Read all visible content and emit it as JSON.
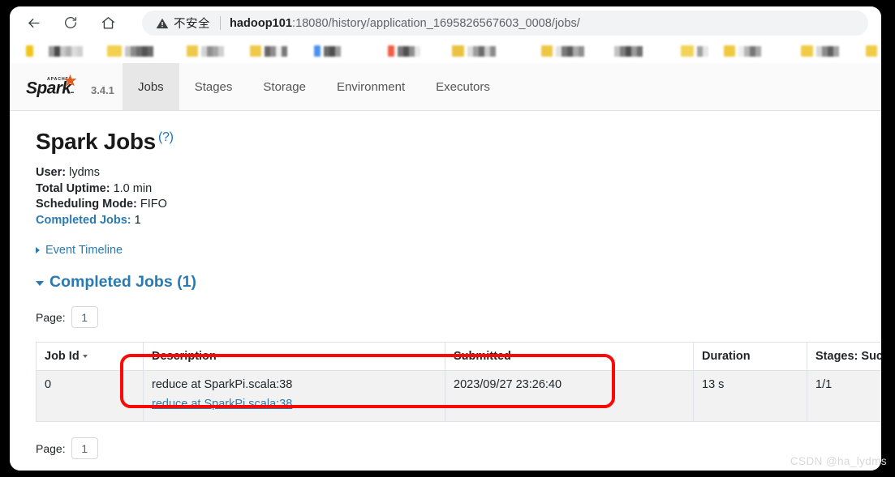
{
  "browser": {
    "nav": {
      "back": "back-arrow",
      "reload": "reload",
      "home": "home"
    },
    "omnibox": {
      "security_label": "不安全",
      "url_host": "hadoop101",
      "url_path": ":18080/history/application_1695826567603_0008/jobs/"
    }
  },
  "spark": {
    "brand": {
      "apache": "APACHE",
      "name": "Spark",
      "version": "3.4.1"
    },
    "tabs": [
      {
        "label": "Jobs",
        "active": true
      },
      {
        "label": "Stages",
        "active": false
      },
      {
        "label": "Storage",
        "active": false
      },
      {
        "label": "Environment",
        "active": false
      },
      {
        "label": "Executors",
        "active": false
      }
    ]
  },
  "page": {
    "title": "Spark Jobs",
    "title_help": "(?)",
    "meta": {
      "user_label": "User:",
      "user_value": "lydms",
      "uptime_label": "Total Uptime:",
      "uptime_value": "1.0 min",
      "scheduling_label": "Scheduling Mode:",
      "scheduling_value": "FIFO",
      "completed_label": "Completed Jobs:",
      "completed_value": "1"
    },
    "event_timeline": "Event Timeline",
    "section_title": "Completed Jobs (1)",
    "page_label_top": "Page:",
    "page_value_top": "1",
    "page_label_bottom": "Page:",
    "page_value_bottom": "1"
  },
  "table": {
    "columns": [
      "Job Id",
      "Description",
      "Submitted",
      "Duration",
      "Stages: Succe"
    ],
    "sorted_column": "Job Id",
    "rows": [
      {
        "job_id": "0",
        "description": "reduce at SparkPi.scala:38",
        "description_link": "reduce at SparkPi.scala:38",
        "submitted": "2023/09/27 23:26:40",
        "duration": "13 s",
        "stages": "1/1"
      }
    ]
  },
  "annotation": {
    "color": "#fa0a07"
  },
  "watermark": "CSDN @ha_lydms"
}
